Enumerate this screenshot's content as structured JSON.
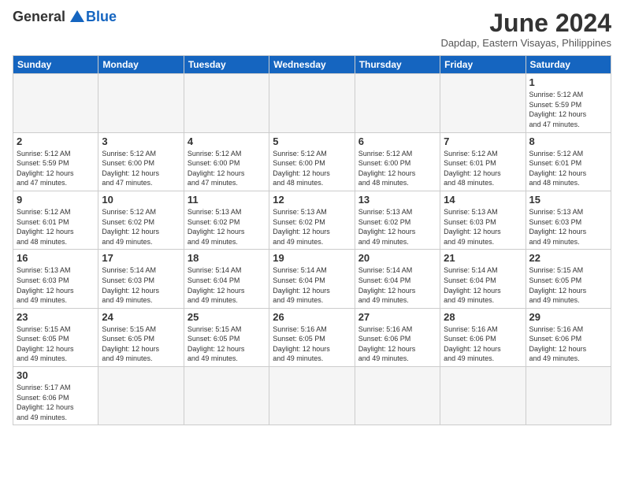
{
  "header": {
    "logo": {
      "text_general": "General",
      "text_blue": "Blue"
    },
    "title": "June 2024",
    "subtitle": "Dapdap, Eastern Visayas, Philippines"
  },
  "days_of_week": [
    "Sunday",
    "Monday",
    "Tuesday",
    "Wednesday",
    "Thursday",
    "Friday",
    "Saturday"
  ],
  "weeks": [
    [
      null,
      null,
      null,
      null,
      null,
      null,
      {
        "day": "1",
        "sunrise": "5:12 AM",
        "sunset": "5:59 PM",
        "daylight_hours": "12",
        "daylight_minutes": "47"
      }
    ],
    [
      {
        "day": "2",
        "sunrise": "5:12 AM",
        "sunset": "5:59 PM",
        "daylight_hours": "12",
        "daylight_minutes": "47"
      },
      {
        "day": "3",
        "sunrise": "5:12 AM",
        "sunset": "6:00 PM",
        "daylight_hours": "12",
        "daylight_minutes": "47"
      },
      {
        "day": "4",
        "sunrise": "5:12 AM",
        "sunset": "6:00 PM",
        "daylight_hours": "12",
        "daylight_minutes": "47"
      },
      {
        "day": "5",
        "sunrise": "5:12 AM",
        "sunset": "6:00 PM",
        "daylight_hours": "12",
        "daylight_minutes": "48"
      },
      {
        "day": "6",
        "sunrise": "5:12 AM",
        "sunset": "6:00 PM",
        "daylight_hours": "12",
        "daylight_minutes": "48"
      },
      {
        "day": "7",
        "sunrise": "5:12 AM",
        "sunset": "6:01 PM",
        "daylight_hours": "12",
        "daylight_minutes": "48"
      },
      {
        "day": "8",
        "sunrise": "5:12 AM",
        "sunset": "6:01 PM",
        "daylight_hours": "12",
        "daylight_minutes": "48"
      }
    ],
    [
      {
        "day": "9",
        "sunrise": "5:12 AM",
        "sunset": "6:01 PM",
        "daylight_hours": "12",
        "daylight_minutes": "48"
      },
      {
        "day": "10",
        "sunrise": "5:12 AM",
        "sunset": "6:02 PM",
        "daylight_hours": "12",
        "daylight_minutes": "49"
      },
      {
        "day": "11",
        "sunrise": "5:13 AM",
        "sunset": "6:02 PM",
        "daylight_hours": "12",
        "daylight_minutes": "49"
      },
      {
        "day": "12",
        "sunrise": "5:13 AM",
        "sunset": "6:02 PM",
        "daylight_hours": "12",
        "daylight_minutes": "49"
      },
      {
        "day": "13",
        "sunrise": "5:13 AM",
        "sunset": "6:02 PM",
        "daylight_hours": "12",
        "daylight_minutes": "49"
      },
      {
        "day": "14",
        "sunrise": "5:13 AM",
        "sunset": "6:03 PM",
        "daylight_hours": "12",
        "daylight_minutes": "49"
      },
      {
        "day": "15",
        "sunrise": "5:13 AM",
        "sunset": "6:03 PM",
        "daylight_hours": "12",
        "daylight_minutes": "49"
      }
    ],
    [
      {
        "day": "16",
        "sunrise": "5:13 AM",
        "sunset": "6:03 PM",
        "daylight_hours": "12",
        "daylight_minutes": "49"
      },
      {
        "day": "17",
        "sunrise": "5:14 AM",
        "sunset": "6:03 PM",
        "daylight_hours": "12",
        "daylight_minutes": "49"
      },
      {
        "day": "18",
        "sunrise": "5:14 AM",
        "sunset": "6:04 PM",
        "daylight_hours": "12",
        "daylight_minutes": "49"
      },
      {
        "day": "19",
        "sunrise": "5:14 AM",
        "sunset": "6:04 PM",
        "daylight_hours": "12",
        "daylight_minutes": "49"
      },
      {
        "day": "20",
        "sunrise": "5:14 AM",
        "sunset": "6:04 PM",
        "daylight_hours": "12",
        "daylight_minutes": "49"
      },
      {
        "day": "21",
        "sunrise": "5:14 AM",
        "sunset": "6:04 PM",
        "daylight_hours": "12",
        "daylight_minutes": "49"
      },
      {
        "day": "22",
        "sunrise": "5:15 AM",
        "sunset": "6:05 PM",
        "daylight_hours": "12",
        "daylight_minutes": "49"
      }
    ],
    [
      {
        "day": "23",
        "sunrise": "5:15 AM",
        "sunset": "6:05 PM",
        "daylight_hours": "12",
        "daylight_minutes": "49"
      },
      {
        "day": "24",
        "sunrise": "5:15 AM",
        "sunset": "6:05 PM",
        "daylight_hours": "12",
        "daylight_minutes": "49"
      },
      {
        "day": "25",
        "sunrise": "5:15 AM",
        "sunset": "6:05 PM",
        "daylight_hours": "12",
        "daylight_minutes": "49"
      },
      {
        "day": "26",
        "sunrise": "5:16 AM",
        "sunset": "6:05 PM",
        "daylight_hours": "12",
        "daylight_minutes": "49"
      },
      {
        "day": "27",
        "sunrise": "5:16 AM",
        "sunset": "6:06 PM",
        "daylight_hours": "12",
        "daylight_minutes": "49"
      },
      {
        "day": "28",
        "sunrise": "5:16 AM",
        "sunset": "6:06 PM",
        "daylight_hours": "12",
        "daylight_minutes": "49"
      },
      {
        "day": "29",
        "sunrise": "5:16 AM",
        "sunset": "6:06 PM",
        "daylight_hours": "12",
        "daylight_minutes": "49"
      }
    ],
    [
      {
        "day": "30",
        "sunrise": "5:17 AM",
        "sunset": "6:06 PM",
        "daylight_hours": "12",
        "daylight_minutes": "49"
      },
      null,
      null,
      null,
      null,
      null,
      null
    ]
  ],
  "labels": {
    "sunrise": "Sunrise:",
    "sunset": "Sunset:",
    "daylight": "Daylight: 12 hours"
  }
}
